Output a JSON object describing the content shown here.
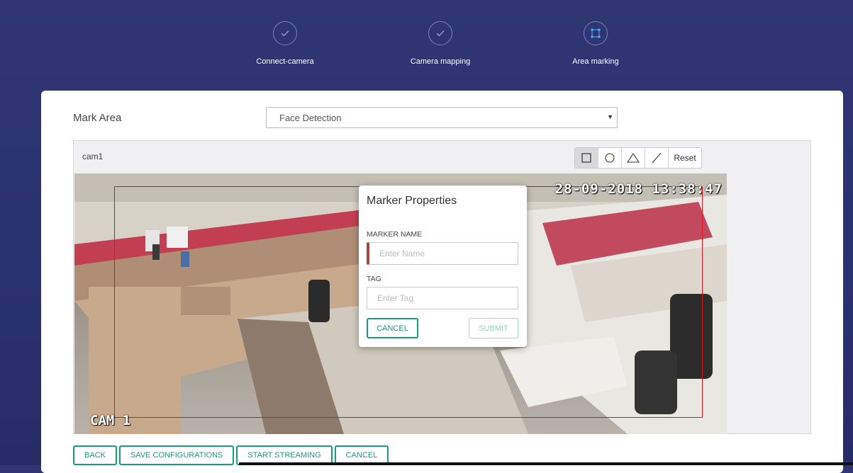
{
  "steps": [
    {
      "label": "Connect-camera",
      "icon": "check-icon"
    },
    {
      "label": "Camera mapping",
      "icon": "check-icon"
    },
    {
      "label": "Area marking",
      "icon": "area-select-icon"
    }
  ],
  "mark_area": {
    "label": "Mark Area",
    "selected_option": "Face Detection"
  },
  "camera": {
    "name": "cam1",
    "timestamp": "28-09-2018 13:38:47",
    "overlay_label": "CAM 1"
  },
  "toolbar": {
    "tools": [
      "rectangle-icon",
      "circle-icon",
      "triangle-icon",
      "line-icon"
    ],
    "reset_label": "Reset"
  },
  "modal": {
    "title": "Marker Properties",
    "marker_name_label": "MARKER NAME",
    "marker_name_placeholder": "Enter Name",
    "tag_label": "TAG",
    "tag_placeholder": "Enter Tag",
    "cancel_label": "CANCEL",
    "submit_label": "SUBMIT"
  },
  "actions": {
    "back": "BACK",
    "save": "SAVE CONFIGURATIONS",
    "stream": "START STREAMING",
    "cancel": "CANCEL"
  },
  "colors": {
    "background": "#2f3672",
    "accent": "#1a9a77",
    "marker": "#e0141e"
  }
}
